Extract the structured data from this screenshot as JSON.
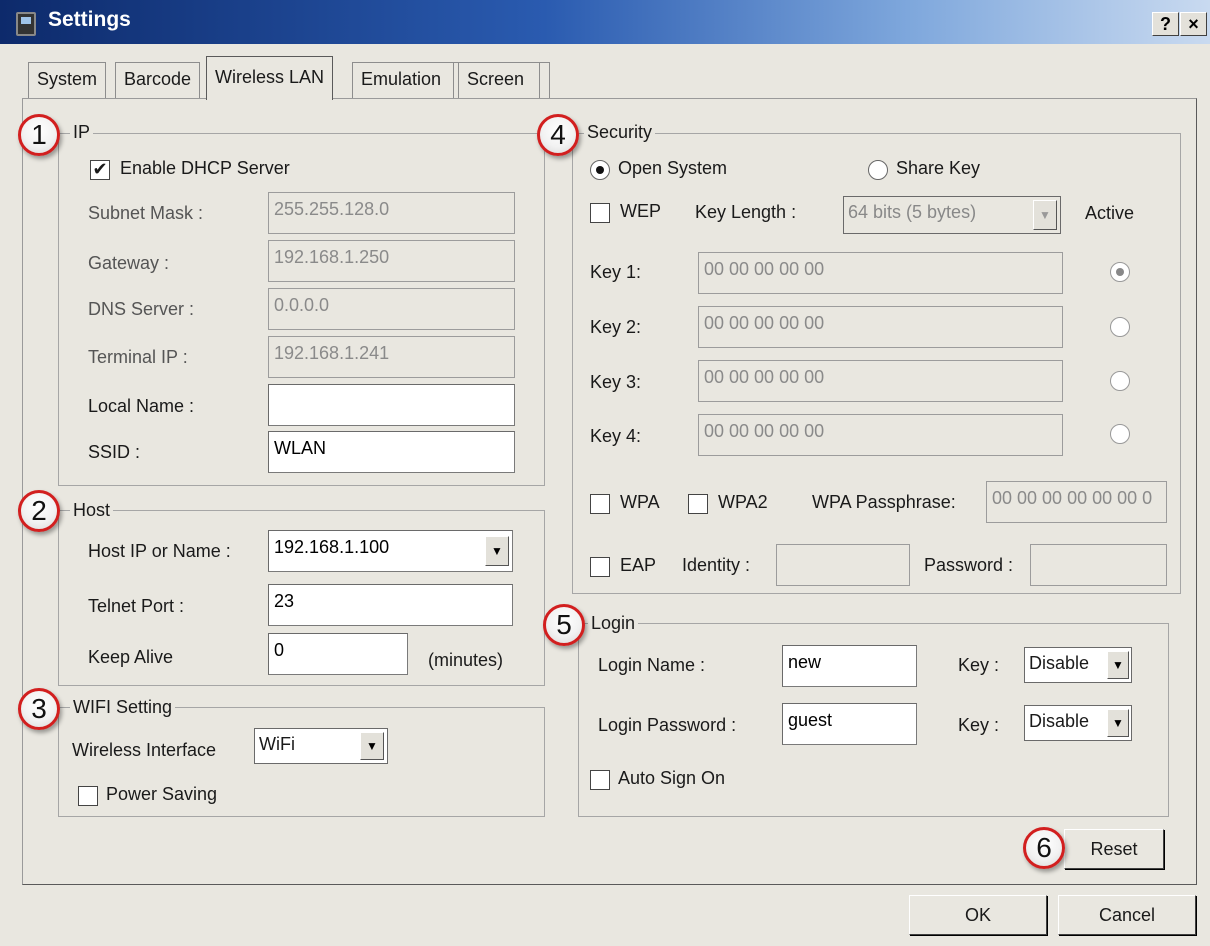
{
  "window": {
    "title": "Settings",
    "help_label": "?",
    "close_label": "×"
  },
  "tabs": [
    {
      "label": "System"
    },
    {
      "label": "Barcode"
    },
    {
      "label": "Wireless LAN"
    },
    {
      "label": "Emulation"
    },
    {
      "label": "Screen"
    }
  ],
  "badges": [
    "1",
    "2",
    "3",
    "4",
    "5",
    "6"
  ],
  "ip": {
    "title": "IP",
    "dhcp_label": "Enable DHCP Server",
    "dhcp_checked": true,
    "subnet_label": "Subnet Mask :",
    "subnet_value": "255.255.128.0",
    "gateway_label": "Gateway :",
    "gateway_value": "192.168.1.250",
    "dns_label": "DNS Server :",
    "dns_value": "0.0.0.0",
    "terminal_label": "Terminal IP :",
    "terminal_value": "192.168.1.241",
    "local_name_label": "Local Name :",
    "local_name_value": "",
    "ssid_label": "SSID :",
    "ssid_value": "WLAN"
  },
  "host": {
    "title": "Host",
    "host_label": "Host IP or Name :",
    "host_value": "192.168.1.100",
    "telnet_label": "Telnet Port :",
    "telnet_value": "23",
    "keepalive_label": "Keep Alive",
    "keepalive_value": "0",
    "keepalive_unit": "(minutes)"
  },
  "wifi": {
    "title": "WIFI Setting",
    "interface_label": "Wireless Interface",
    "interface_value": "WiFi",
    "power_saving_label": "Power Saving",
    "power_saving_checked": false
  },
  "security": {
    "title": "Security",
    "open_system_label": "Open System",
    "share_key_label": "Share Key",
    "wep_label": "WEP",
    "key_length_label": "Key Length :",
    "key_length_value": "64 bits (5 bytes)",
    "active_label": "Active",
    "keys": [
      {
        "label": "Key 1:",
        "value": "00 00 00 00 00",
        "active": true
      },
      {
        "label": "Key 2:",
        "value": "00 00 00 00 00",
        "active": false
      },
      {
        "label": "Key 3:",
        "value": "00 00 00 00 00",
        "active": false
      },
      {
        "label": "Key 4:",
        "value": "00 00 00 00 00",
        "active": false
      }
    ],
    "wpa_label": "WPA",
    "wpa2_label": "WPA2",
    "passphrase_label": "WPA Passphrase:",
    "passphrase_value": "00 00 00 00 00 00 0",
    "eap_label": "EAP",
    "identity_label": "Identity :",
    "identity_value": "",
    "password_label": "Password :",
    "password_value": ""
  },
  "login": {
    "title": "Login",
    "name_label": "Login Name :",
    "name_value": "new",
    "name_key_label": "Key :",
    "name_key_value": "Disable",
    "password_label": "Login Password :",
    "password_value": "guest",
    "password_key_label": "Key :",
    "password_key_value": "Disable",
    "auto_sign_on_label": "Auto Sign On"
  },
  "buttons": {
    "reset": "Reset",
    "ok": "OK",
    "cancel": "Cancel"
  },
  "icons": {
    "dropdown": "▼",
    "check": "✔"
  }
}
